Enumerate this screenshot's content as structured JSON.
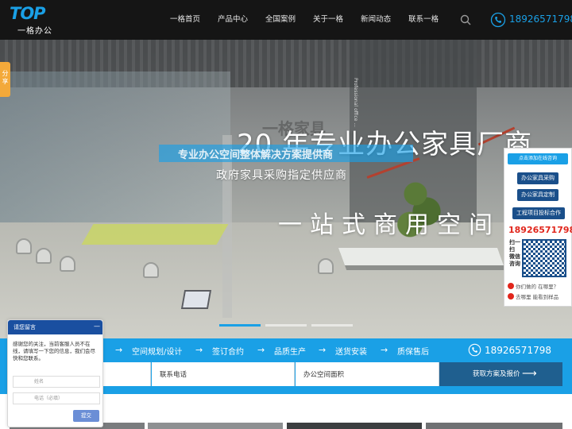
{
  "header": {
    "logo_text": "TOP",
    "logo_sub": "一格办公",
    "nav": [
      "一格首页",
      "产品中心",
      "全国案例",
      "关于一格",
      "新闻动态",
      "联系一格"
    ],
    "phone": "18926571798"
  },
  "banner": {
    "title_num": "20",
    "title_rest": "年专业办公家具厂商",
    "strip_text": "专业办公空间整体解决方案提供商",
    "subtitle": "政府家具采购指定供应商",
    "line": "一站式商用空间",
    "ghost_text": "一格家具",
    "vertical_text": "Professional office ...",
    "slides": 3,
    "active_slide": 0
  },
  "share_tab": {
    "label": "分享"
  },
  "float_panel": {
    "header": "点击添加在线咨询",
    "buttons": [
      "办公家具采购",
      "办公家具定制",
      "工程项目投标合作"
    ],
    "phone": "18926571798",
    "scan_text": "扫一扫 微信咨询",
    "rows": [
      "你们做的 在哪里？",
      "去哪里 能看到样品"
    ]
  },
  "process": {
    "steps": [
      "空间规划/设计",
      "签订合约",
      "品质生产",
      "送货安装",
      "质保售后"
    ],
    "phone": "18926571798"
  },
  "form": {
    "fields": [
      "",
      "联系电话",
      "办公空间面积"
    ],
    "submit": "获取方案及报价"
  },
  "chat": {
    "title": "请您留言",
    "message": "感谢您的关注，当前客服人员不在线，请填写一下您的信息，我们会尽快和您联系。",
    "name_placeholder": "姓名",
    "phone_placeholder": "电话（必填）",
    "send": "提交"
  },
  "colors": {
    "accent": "#1aa0e6",
    "header_bg": "#151515",
    "dark_blue": "#1f5f8f",
    "phone_red": "#e1261c"
  }
}
